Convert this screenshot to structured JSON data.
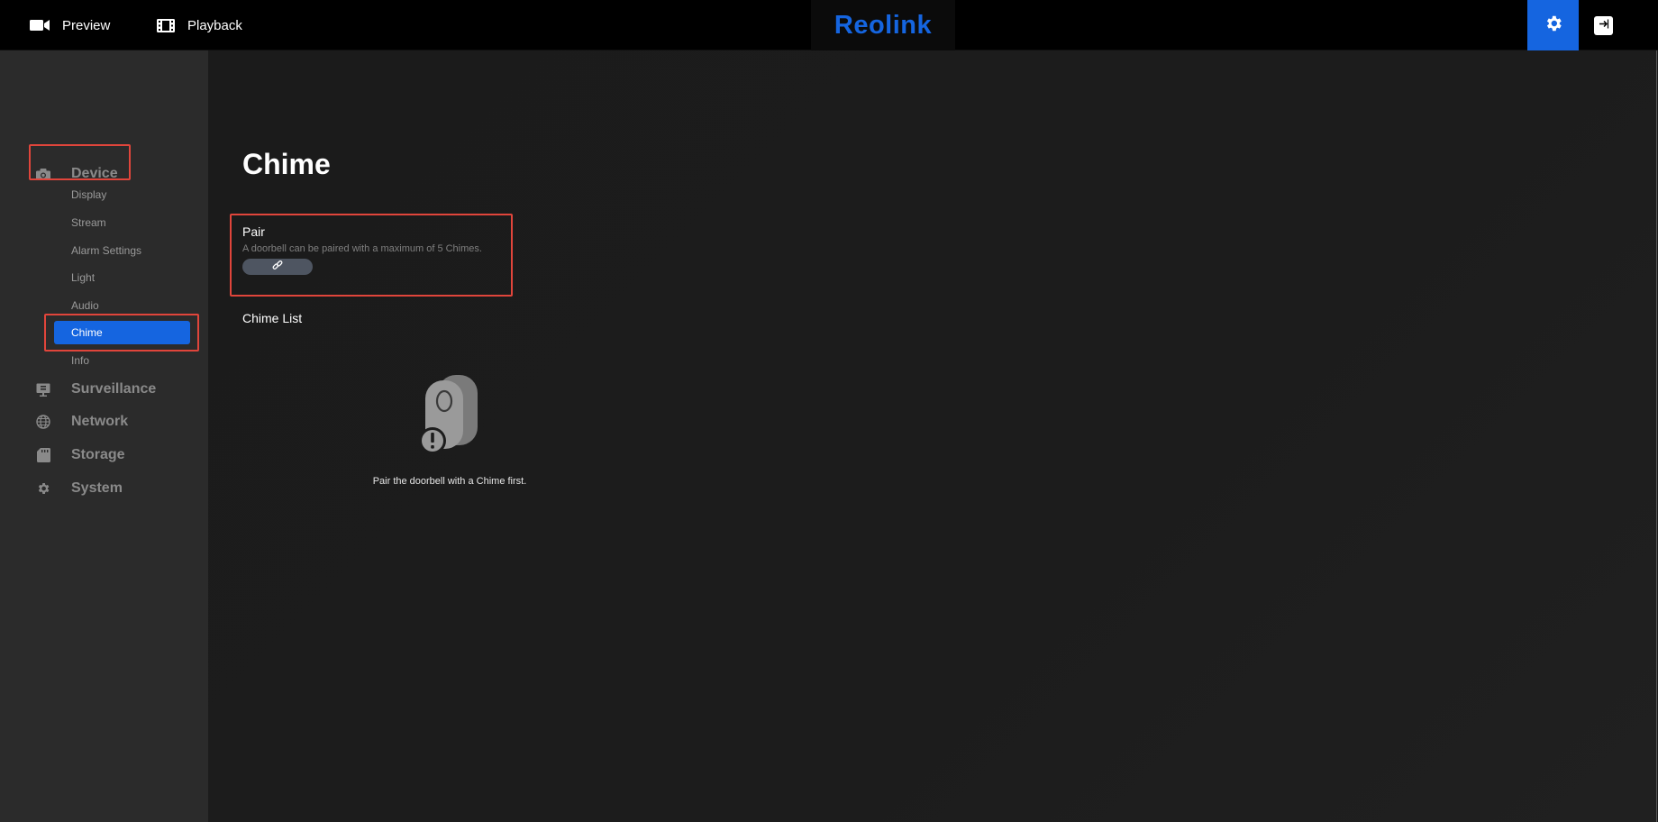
{
  "topbar": {
    "preview_label": "Preview",
    "playback_label": "Playback",
    "logo_text": "Reolink",
    "icons": {
      "preview": "video-camera-icon",
      "playback": "film-icon",
      "settings": "gear-icon",
      "logout": "logout-icon"
    }
  },
  "sidebar": {
    "groups": [
      {
        "label": "Device",
        "icon": "camera-icon",
        "items": [
          {
            "label": "Display"
          },
          {
            "label": "Stream"
          },
          {
            "label": "Alarm Settings"
          },
          {
            "label": "Light"
          },
          {
            "label": "Audio"
          },
          {
            "label": "Chime",
            "active": true
          },
          {
            "label": "Info"
          }
        ]
      },
      {
        "label": "Surveillance",
        "icon": "monitor-icon"
      },
      {
        "label": "Network",
        "icon": "globe-icon"
      },
      {
        "label": "Storage",
        "icon": "sd-card-icon"
      },
      {
        "label": "System",
        "icon": "gear-icon"
      }
    ]
  },
  "main": {
    "title": "Chime",
    "pair": {
      "title": "Pair",
      "description": "A doorbell can be paired with a maximum of 5 Chimes.",
      "button_icon": "link-icon"
    },
    "chime_list": {
      "title": "Chime List",
      "empty_icon": "chime-warning-icon",
      "empty_text": "Pair the doorbell with a Chime first."
    }
  },
  "colors": {
    "accent": "#1565e0",
    "highlight": "#e0453b",
    "sidebar_bg": "#2b2b2b",
    "topbar_bg": "#000000",
    "main_bg": "#1c1c1c"
  }
}
